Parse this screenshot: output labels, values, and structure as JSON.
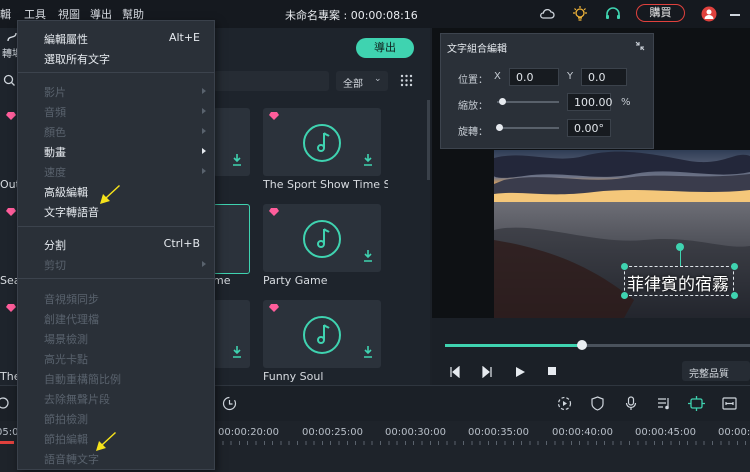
{
  "topbar": {
    "menus": [
      "輯",
      "工具",
      "視圖",
      "導出",
      "幫助"
    ],
    "project_title": "未命名專案 : 00:00:08:16",
    "buy_label": "購買"
  },
  "left_panel": {
    "cut_label_left": "轉場",
    "export_label": "導出",
    "filter_label": "全部",
    "cards": [
      {
        "title": "The Sport Show Time S..."
      },
      {
        "title": "Party Game"
      },
      {
        "title": "Funny Soul"
      }
    ],
    "partial_labels": [
      "Out",
      "Sea",
      "The"
    ],
    "partial_mid_label": "me"
  },
  "dropdown": {
    "items": [
      {
        "label": "編輯屬性",
        "shortcut": "Alt+E",
        "enabled": true
      },
      {
        "label": "選取所有文字",
        "shortcut": "",
        "enabled": true
      },
      {
        "label": "影片",
        "shortcut": "",
        "enabled": false,
        "submenu": true
      },
      {
        "label": "音頻",
        "shortcut": "",
        "enabled": false,
        "submenu": true
      },
      {
        "label": "顏色",
        "shortcut": "",
        "enabled": false,
        "submenu": true
      },
      {
        "label": "動畫",
        "shortcut": "",
        "enabled": true,
        "submenu": true
      },
      {
        "label": "速度",
        "shortcut": "",
        "enabled": false,
        "submenu": true
      },
      {
        "label": "高級編輯",
        "shortcut": "",
        "enabled": true
      },
      {
        "label": "文字轉語音",
        "shortcut": "",
        "enabled": true
      },
      {
        "label": "分割",
        "shortcut": "Ctrl+B",
        "enabled": true
      },
      {
        "label": "剪切",
        "shortcut": "",
        "enabled": false,
        "submenu": true
      },
      {
        "label": "音視頻同步",
        "shortcut": "",
        "enabled": false
      },
      {
        "label": "創建代理檔",
        "shortcut": "",
        "enabled": false
      },
      {
        "label": "場景檢測",
        "shortcut": "",
        "enabled": false
      },
      {
        "label": "高光卡點",
        "shortcut": "",
        "enabled": false
      },
      {
        "label": "自動重構簡比例",
        "shortcut": "",
        "enabled": false
      },
      {
        "label": "去除無聲片段",
        "shortcut": "",
        "enabled": false
      },
      {
        "label": "節拍檢測",
        "shortcut": "",
        "enabled": false
      },
      {
        "label": "節拍編輯",
        "shortcut": "",
        "enabled": false
      },
      {
        "label": "語音轉文字",
        "shortcut": "",
        "enabled": false
      }
    ]
  },
  "text_panel": {
    "title": "文字組合編輯",
    "position_label": "位置：",
    "x_label": "X",
    "x_value": "0.0",
    "y_label": "Y",
    "y_value": "0.0",
    "scale_label": "縮放：",
    "scale_value": "100.00",
    "scale_unit": "%",
    "rotate_label": "旋轉：",
    "rotate_value": "0.00°",
    "scale_slider_fraction": 0.05,
    "rotate_slider_fraction": 0.0
  },
  "preview": {
    "caption": "菲律賓的宿霧",
    "quality_label": "完整品質",
    "playback_progress": 0.45
  },
  "timeline": {
    "ticks": [
      "05:00",
      "00:00:20:00",
      "00:00:25:00",
      "00:00:30:00",
      "00:00:35:00",
      "00:00:40:00",
      "00:00:45:00",
      "00:00:5"
    ]
  },
  "colors": {
    "accent": "#3fd3b0",
    "buy_red": "#e0413d",
    "arrow_yellow": "#f5e21b"
  }
}
